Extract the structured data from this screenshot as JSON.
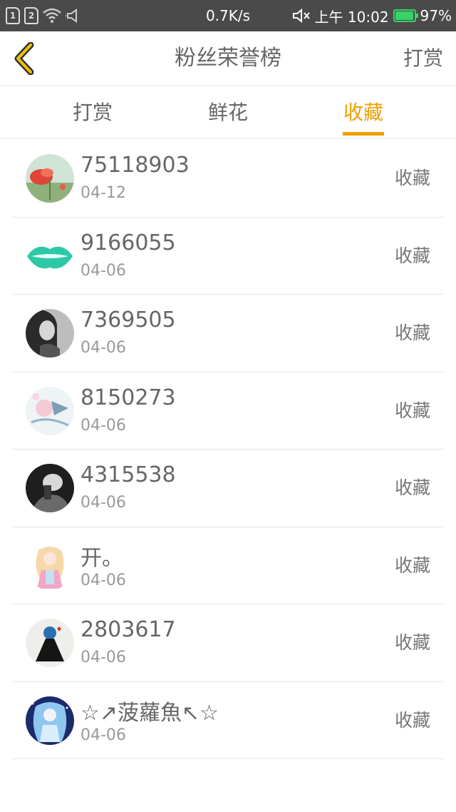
{
  "status_bar": {
    "sim1": "1",
    "sim2": "2",
    "net_speed": "0.7K/s",
    "time": "上午 10:02",
    "battery": "97%",
    "battery_level": 0.97
  },
  "header": {
    "title": "粉丝荣誉榜",
    "reward_label": "打赏"
  },
  "tabs": [
    {
      "label": "打赏",
      "active": false
    },
    {
      "label": "鲜花",
      "active": false
    },
    {
      "label": "收藏",
      "active": true
    }
  ],
  "colors": {
    "accent": "#f0a000",
    "status_bar_bg": "#4a4a4a",
    "battery": "#3ad16b",
    "text": "#666666",
    "subtext": "#999999"
  },
  "list": [
    {
      "name": "75118903",
      "date": "04-12",
      "action": "收藏",
      "avatar_icon": "poppy-flower-avatar"
    },
    {
      "name": "9166055",
      "date": "04-06",
      "action": "收藏",
      "avatar_icon": "teal-lips-avatar"
    },
    {
      "name": "7369505",
      "date": "04-06",
      "action": "收藏",
      "avatar_icon": "bw-portrait-avatar"
    },
    {
      "name": "8150273",
      "date": "04-06",
      "action": "收藏",
      "avatar_icon": "illustration-avatar"
    },
    {
      "name": "4315538",
      "date": "04-06",
      "action": "收藏",
      "avatar_icon": "dark-portrait-avatar"
    },
    {
      "name": "开。",
      "date": "04-06",
      "action": "收藏",
      "avatar_icon": "anime-girl-avatar"
    },
    {
      "name": "2803617",
      "date": "04-06",
      "action": "收藏",
      "avatar_icon": "dark-dress-avatar"
    },
    {
      "name": "☆↗菠蘿魚↖☆",
      "date": "04-06",
      "action": "收藏",
      "avatar_icon": "blue-anime-avatar"
    }
  ]
}
